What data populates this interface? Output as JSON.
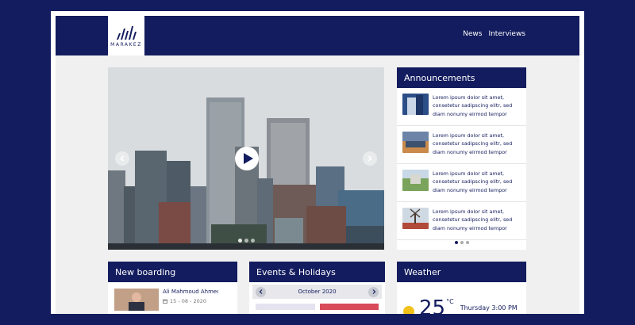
{
  "brand": {
    "logo_text": "MARAKEZ"
  },
  "nav": {
    "items": [
      "News",
      "Interviews"
    ]
  },
  "carousel": {
    "slides_count": 3,
    "active_slide": 1
  },
  "announcements": {
    "title": "Announcements",
    "items": [
      {
        "text": "Lorem ipsum dolor sit amet, consetetur sadipscing elitr, sed diam nonumy eirmod tempor",
        "thumb": "building"
      },
      {
        "text": "Lorem ipsum dolor sit amet, consetetur sadipscing elitr, sed diam nonumy eirmod tempor",
        "thumb": "street"
      },
      {
        "text": "Lorem ipsum dolor sit amet, consetetur sadipscing elitr, sed diam nonumy eirmod tempor",
        "thumb": "park"
      },
      {
        "text": "Lorem ipsum dolor sit amet, consetetur sadipscing elitr, sed diam nonumy eirmod tempor",
        "thumb": "windmill"
      }
    ],
    "pager_count": 3,
    "pager_active": 1
  },
  "boarding": {
    "title": "New boarding",
    "person": {
      "name": "Ali Mahmoud Ahmed",
      "date": "15 - 08 - 2020"
    }
  },
  "events": {
    "title": "Events & Holidays",
    "month": "October 2020"
  },
  "weather": {
    "title": "Weather",
    "temp": "25",
    "unit": "°C",
    "day": "Thursday 3:00 PM"
  },
  "colors": {
    "primary": "#131c5e",
    "background": "#f0f0f0",
    "accent_red": "#d84b58",
    "sun": "#f2c21b"
  }
}
